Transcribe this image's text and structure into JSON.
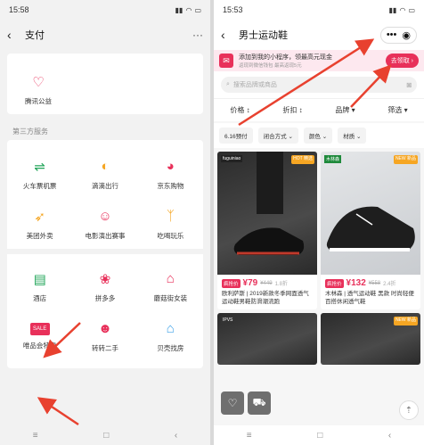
{
  "left": {
    "status_time": "15:58",
    "nav_title": "支付",
    "nav_more": "···",
    "top_service": {
      "label": "腾讯公益",
      "icon": "heart-icon"
    },
    "section_label": "第三方服务",
    "services_1": [
      {
        "label": "火车票机票",
        "icon": "train-icon",
        "color": "#22a559"
      },
      {
        "label": "滴滴出行",
        "icon": "didi-icon",
        "color": "#f5a623"
      },
      {
        "label": "京东购物",
        "icon": "jd-icon",
        "color": "#e8305a"
      },
      {
        "label": "美团外卖",
        "icon": "kangaroo-icon",
        "color": "#f5a623"
      },
      {
        "label": "电影演出赛事",
        "icon": "maoyan-icon",
        "color": "#e8305a"
      },
      {
        "label": "吃喝玩乐",
        "icon": "person-icon",
        "color": "#f5a623"
      }
    ],
    "services_2": [
      {
        "label": "酒店",
        "icon": "hotel-icon",
        "color": "#22a559"
      },
      {
        "label": "拼多多",
        "icon": "pdd-icon",
        "color": "#e8305a"
      },
      {
        "label": "蘑菇街女装",
        "icon": "mushroom-icon",
        "color": "#e8305a"
      },
      {
        "label": "唯品会特卖",
        "icon": "sale-icon",
        "color": "#e8305a",
        "badge": "SALE"
      },
      {
        "label": "转转二手",
        "icon": "zhuanzhuan-icon",
        "color": "#e8305a"
      },
      {
        "label": "贝壳找房",
        "icon": "house-icon",
        "color": "#3fa2e8"
      }
    ]
  },
  "right": {
    "status_time": "15:53",
    "nav_title": "男士运动鞋",
    "banner_title": "添加到我的小程序，领最高元现金",
    "banner_sub": "返现到微信钱包 最高返现5元",
    "banner_button": "去领取 ›",
    "search_placeholder": "搜索品牌或商品",
    "sorts": [
      "价格 ↕",
      "折扣 ↕",
      "品牌 ▾",
      "筛选 ▾"
    ],
    "filters": [
      "6.16预付",
      "闭合方式 ⌄",
      "颜色 ⌄",
      "材质 ⌄"
    ],
    "products": [
      {
        "badge": "疯抢价",
        "price": "¥79",
        "orig": "¥449",
        "sold": "1.8折",
        "name": "欧利萨斯 | 2019新款冬季网面透气运动鞋男鞋防滑潮流跑",
        "tone": "dark",
        "hot": "HOT\n精选",
        "brand": "fuguiniao"
      },
      {
        "badge": "疯抢价",
        "price": "¥132",
        "orig": "¥558",
        "sold": "2.4折",
        "name": "木林森 | 透气运动鞋 黑款 时尚轻便百搭休闲透气鞋",
        "tone": "light",
        "hot": "NEW\n新品",
        "brand": "木林森"
      },
      {
        "tone": "dark",
        "hot": "",
        "brand": "IPVS"
      },
      {
        "tone": "dark",
        "hot": "NEW\n新品",
        "brand": ""
      }
    ]
  },
  "colors": {
    "accent": "#e8305a",
    "arrow": "#e8412f"
  }
}
